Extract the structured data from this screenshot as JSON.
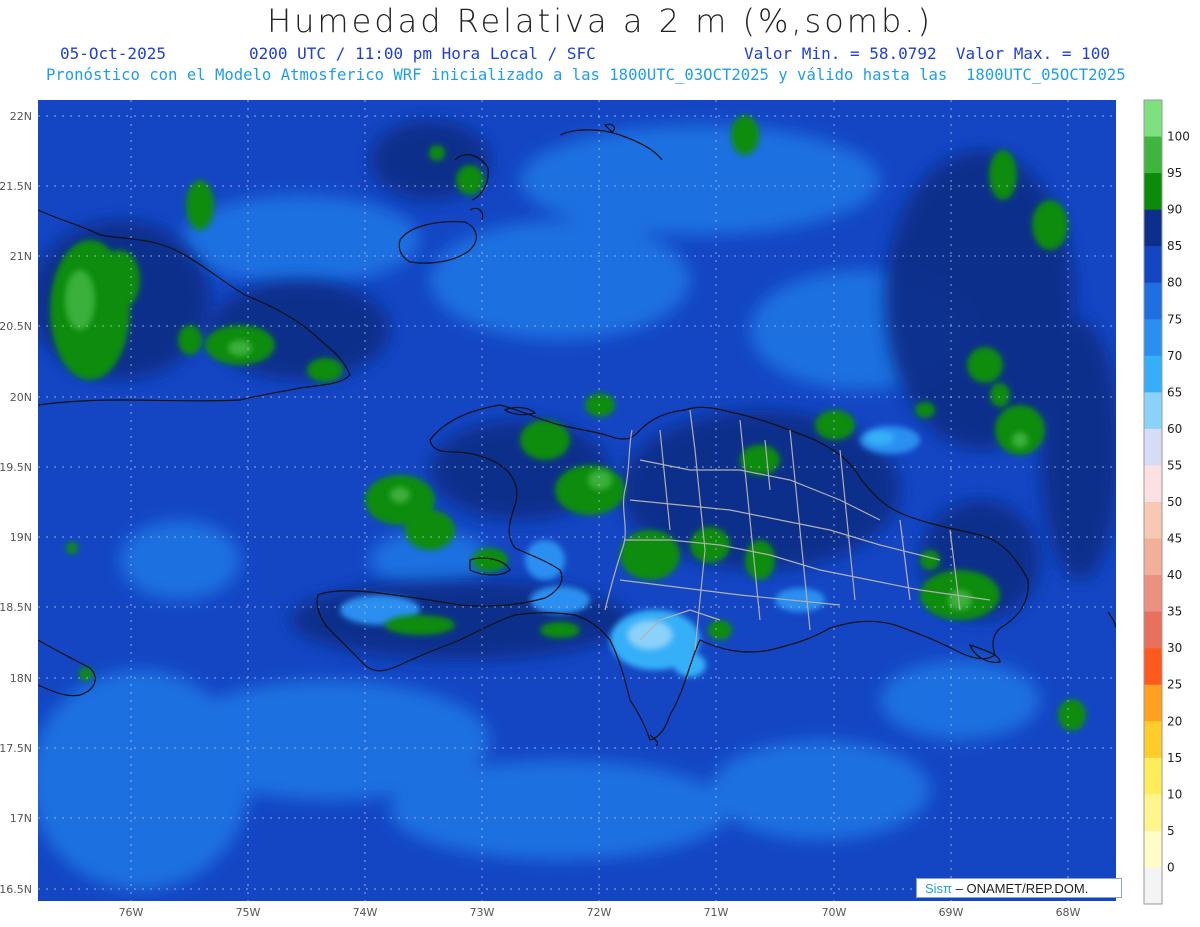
{
  "title": "Humedad Relativa a 2 m (%,somb.)",
  "date": "05-Oct-2025",
  "time_line": "0200 UTC / 11:00 pm Hora Local / SFC",
  "minmax_line": "Valor Min. = 58.0792  Valor Max. = 100",
  "model_line": "Pronóstico con el Modelo Atmosferico WRF inicializado a las 1800UTC_03OCT2025 y válido hasta las  1800UTC_05OCT2025",
  "lat_labels": [
    "22N",
    "21.5N",
    "21N",
    "20.5N",
    "20N",
    "19.5N",
    "19N",
    "18.5N",
    "18N",
    "17.5N",
    "17N",
    "16.5N"
  ],
  "lon_labels": [
    "76W",
    "75W",
    "74W",
    "73W",
    "72W",
    "71W",
    "70W",
    "69W",
    "68W"
  ],
  "colorbar": {
    "labels": [
      "100",
      "95",
      "90",
      "85",
      "80",
      "75",
      "70",
      "65",
      "60",
      "55",
      "50",
      "45",
      "40",
      "35",
      "30",
      "25",
      "20",
      "15",
      "10",
      "5",
      "0"
    ],
    "colors": [
      "#7fe07f",
      "#3fb43f",
      "#0a8c0a",
      "#0b2f8a",
      "#1446c4",
      "#1f6fe0",
      "#2a8ff0",
      "#35b0f8",
      "#8ad2fa",
      "#d6dcf6",
      "#fde0e4",
      "#f7c8b4",
      "#f2b09a",
      "#ec9080",
      "#e8705c",
      "#ff5a1e",
      "#ffa020",
      "#ffcc2a",
      "#ffec5a",
      "#fff58c",
      "#fffcc8",
      "#f4f4f4"
    ]
  },
  "legend": {
    "brand": "Sisπ",
    "org": " – ONAMET/REP.DOM."
  }
}
